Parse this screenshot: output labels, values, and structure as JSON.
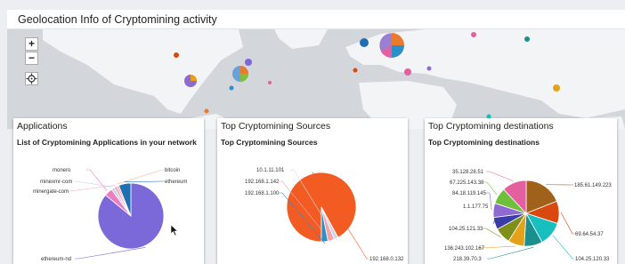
{
  "dashboard": {
    "title": "Geolocation Info of Cryptomining activity"
  },
  "map": {
    "zoom_in_label": "+",
    "zoom_out_label": "−",
    "locate_icon": "crosshair-icon"
  },
  "cards": [
    {
      "title": "Applications",
      "subtitle": "List of Cryptomining Applications in your network",
      "chart_data": {
        "type": "pie",
        "title": "List of Cryptomining Applications in your network",
        "slices": [
          {
            "label": "ethereum-nd",
            "value": 86,
            "color": "#7b68d9"
          },
          {
            "label": "monero",
            "value": 4,
            "color": "#e97fc0"
          },
          {
            "label": "minexmr-com",
            "value": 1.5,
            "color": "#c9d0e8"
          },
          {
            "label": "minergate-com",
            "value": 1.5,
            "color": "#f3a6c7"
          },
          {
            "label": "bitcoin",
            "value": 1,
            "color": "#f2b29a"
          },
          {
            "label": "ethereum",
            "value": 6,
            "color": "#1f6fb2"
          }
        ]
      }
    },
    {
      "title": "Top Cryptomining Sources",
      "subtitle": "Top Cryptomining Sources",
      "chart_data": {
        "type": "pie",
        "title": "Top Cryptomining Sources",
        "slices": [
          {
            "label": "192.168.0.132",
            "value": 92,
            "color": "#f25c22"
          },
          {
            "label": "10.1.11.101",
            "value": 2,
            "color": "#cfd6e4"
          },
          {
            "label": "192.168.1.142",
            "value": 3,
            "color": "#f4a3a8"
          },
          {
            "label": "192.168.1.100",
            "value": 3,
            "color": "#2d8fc9"
          }
        ]
      }
    },
    {
      "title": "Top Cryptomining destinations",
      "subtitle": "Top Cryptomining destinations",
      "chart_data": {
        "type": "pie",
        "title": "Top Cryptomining destinations",
        "slices": [
          {
            "label": "185.61.149.223",
            "value": 19,
            "color": "#a0611a"
          },
          {
            "label": "69.64.54.37",
            "value": 11,
            "color": "#d9480f"
          },
          {
            "label": "104.25.120.33",
            "value": 12,
            "color": "#17bfbf"
          },
          {
            "label": "218.39.70.3",
            "value": 9,
            "color": "#1b8f8f"
          },
          {
            "label": "136.243.102.167",
            "value": 8,
            "color": "#e3a21a"
          },
          {
            "label": "104.25.121.33",
            "value": 8,
            "color": "#7f8f1a"
          },
          {
            "label": "1.1.177.75",
            "value": 6,
            "color": "#3a3da8"
          },
          {
            "label": "84.18.119.145",
            "value": 7,
            "color": "#8d6bd1"
          },
          {
            "label": "67.225.143.38",
            "value": 8,
            "color": "#6fbf3a"
          },
          {
            "label": "35.128.28.51",
            "value": 12,
            "color": "#e35fa0"
          }
        ]
      }
    }
  ]
}
